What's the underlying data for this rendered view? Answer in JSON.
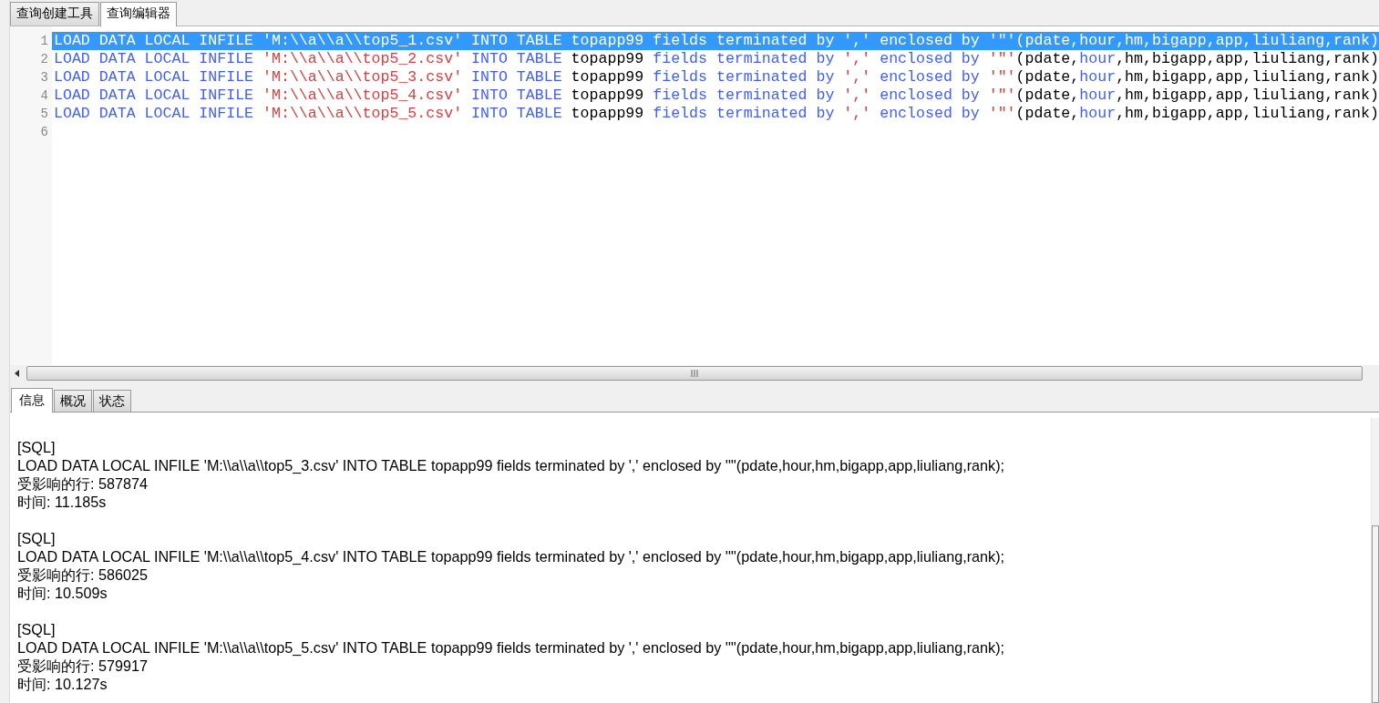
{
  "top_tabs": [
    {
      "label": "查询创建工具",
      "selected": false
    },
    {
      "label": "查询编辑器",
      "selected": true
    }
  ],
  "editor": {
    "lines": [
      {
        "number": "1",
        "selected": true,
        "tokens": [
          {
            "text": "LOAD DATA LOCAL INFILE ",
            "kind": "keyword"
          },
          {
            "text": "'M:\\\\a\\\\a\\\\top5_1.csv'",
            "kind": "string"
          },
          {
            "text": " INTO TABLE ",
            "kind": "keyword"
          },
          {
            "text": "topapp99",
            "kind": "plain"
          },
          {
            "text": " fields terminated by ",
            "kind": "keyword"
          },
          {
            "text": "','",
            "kind": "string"
          },
          {
            "text": " enclosed by ",
            "kind": "keyword"
          },
          {
            "text": "'\"'",
            "kind": "string"
          },
          {
            "text": "(pdate,",
            "kind": "plain"
          },
          {
            "text": "hour",
            "kind": "keyword"
          },
          {
            "text": ",hm,bigapp,app,liuliang,rank)",
            "kind": "plain"
          }
        ]
      },
      {
        "number": "2",
        "selected": false,
        "tokens": [
          {
            "text": "LOAD DATA LOCAL INFILE ",
            "kind": "keyword"
          },
          {
            "text": "'M:\\\\a\\\\a\\\\top5_2.csv'",
            "kind": "string"
          },
          {
            "text": " INTO TABLE ",
            "kind": "keyword"
          },
          {
            "text": "topapp99",
            "kind": "plain"
          },
          {
            "text": " fields terminated by ",
            "kind": "keyword"
          },
          {
            "text": "','",
            "kind": "string"
          },
          {
            "text": " enclosed by ",
            "kind": "keyword"
          },
          {
            "text": "'\"'",
            "kind": "string"
          },
          {
            "text": "(pdate,",
            "kind": "plain"
          },
          {
            "text": "hour",
            "kind": "keyword"
          },
          {
            "text": ",hm,bigapp,app,liuliang,rank)",
            "kind": "plain"
          }
        ]
      },
      {
        "number": "3",
        "selected": false,
        "tokens": [
          {
            "text": "LOAD DATA LOCAL INFILE ",
            "kind": "keyword"
          },
          {
            "text": "'M:\\\\a\\\\a\\\\top5_3.csv'",
            "kind": "string"
          },
          {
            "text": " INTO TABLE ",
            "kind": "keyword"
          },
          {
            "text": "topapp99",
            "kind": "plain"
          },
          {
            "text": " fields terminated by ",
            "kind": "keyword"
          },
          {
            "text": "','",
            "kind": "string"
          },
          {
            "text": " enclosed by ",
            "kind": "keyword"
          },
          {
            "text": "'\"'",
            "kind": "string"
          },
          {
            "text": "(pdate,",
            "kind": "plain"
          },
          {
            "text": "hour",
            "kind": "keyword"
          },
          {
            "text": ",hm,bigapp,app,liuliang,rank)",
            "kind": "plain"
          }
        ]
      },
      {
        "number": "4",
        "selected": false,
        "tokens": [
          {
            "text": "LOAD DATA LOCAL INFILE ",
            "kind": "keyword"
          },
          {
            "text": "'M:\\\\a\\\\a\\\\top5_4.csv'",
            "kind": "string"
          },
          {
            "text": " INTO TABLE ",
            "kind": "keyword"
          },
          {
            "text": "topapp99",
            "kind": "plain"
          },
          {
            "text": " fields terminated by ",
            "kind": "keyword"
          },
          {
            "text": "','",
            "kind": "string"
          },
          {
            "text": " enclosed by ",
            "kind": "keyword"
          },
          {
            "text": "'\"'",
            "kind": "string"
          },
          {
            "text": "(pdate,",
            "kind": "plain"
          },
          {
            "text": "hour",
            "kind": "keyword"
          },
          {
            "text": ",hm,bigapp,app,liuliang,rank)",
            "kind": "plain"
          }
        ]
      },
      {
        "number": "5",
        "selected": false,
        "tokens": [
          {
            "text": "LOAD DATA LOCAL INFILE ",
            "kind": "keyword"
          },
          {
            "text": "'M:\\\\a\\\\a\\\\top5_5.csv'",
            "kind": "string"
          },
          {
            "text": " INTO TABLE ",
            "kind": "keyword"
          },
          {
            "text": "topapp99",
            "kind": "plain"
          },
          {
            "text": " fields terminated by ",
            "kind": "keyword"
          },
          {
            "text": "','",
            "kind": "string"
          },
          {
            "text": " enclosed by ",
            "kind": "keyword"
          },
          {
            "text": "'\"'",
            "kind": "string"
          },
          {
            "text": "(pdate,",
            "kind": "plain"
          },
          {
            "text": "hour",
            "kind": "keyword"
          },
          {
            "text": ",hm,bigapp,app,liuliang,rank)",
            "kind": "plain"
          }
        ]
      },
      {
        "number": "6",
        "selected": false
      }
    ]
  },
  "result_tabs": [
    {
      "label": "信息",
      "selected": true
    },
    {
      "label": "概况",
      "selected": false
    },
    {
      "label": "状态",
      "selected": false
    }
  ],
  "messages": [
    {
      "header": "[SQL]",
      "sql": "LOAD DATA LOCAL INFILE 'M:\\\\a\\\\a\\\\top5_3.csv' INTO TABLE topapp99 fields terminated by ',' enclosed by '\"'(pdate,hour,hm,bigapp,app,liuliang,rank);",
      "affected": "受影响的行: 587874",
      "time": "时间: 11.185s"
    },
    {
      "header": "[SQL]",
      "sql": "LOAD DATA LOCAL INFILE 'M:\\\\a\\\\a\\\\top5_4.csv' INTO TABLE topapp99 fields terminated by ',' enclosed by '\"'(pdate,hour,hm,bigapp,app,liuliang,rank);",
      "affected": "受影响的行: 586025",
      "time": "时间: 10.509s"
    },
    {
      "header": "[SQL]",
      "sql": "LOAD DATA LOCAL INFILE 'M:\\\\a\\\\a\\\\top5_5.csv' INTO TABLE topapp99 fields terminated by ',' enclosed by '\"'(pdate,hour,hm,bigapp,app,liuliang,rank);",
      "affected": "受影响的行: 579917",
      "time": "时间: 10.127s"
    }
  ]
}
